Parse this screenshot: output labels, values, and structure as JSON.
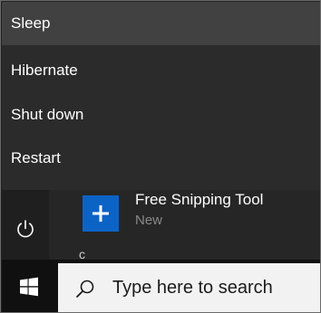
{
  "power_menu": {
    "items": [
      {
        "label": "Sleep"
      },
      {
        "label": "Hibernate"
      },
      {
        "label": "Shut down"
      },
      {
        "label": "Restart"
      }
    ]
  },
  "start_menu": {
    "power_icon": "power-icon",
    "app": {
      "name": "Free Snipping Tool",
      "badge": "New",
      "icon": "plus-icon",
      "tile_color": "#0c63c6"
    },
    "partial_letter": "c"
  },
  "taskbar": {
    "start_icon": "windows-logo-icon",
    "search": {
      "placeholder": "Type here to search",
      "icon": "search-icon"
    }
  },
  "colors": {
    "menu_background": "#2b2b2b",
    "menu_hover": "#414141",
    "taskbar": "#101010",
    "search_box": "#f2f2f2"
  }
}
